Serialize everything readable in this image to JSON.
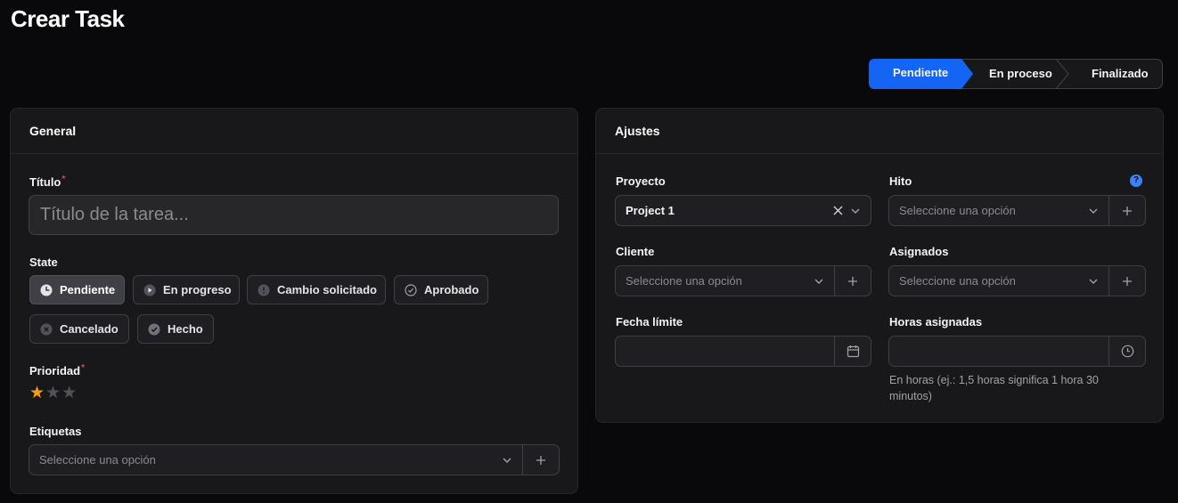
{
  "page": {
    "title": "Crear Task"
  },
  "stepper": {
    "steps": [
      {
        "label": "Pendiente",
        "active": true
      },
      {
        "label": "En proceso",
        "active": false
      },
      {
        "label": "Finalizado",
        "active": false
      }
    ],
    "active_color": "#1565f5"
  },
  "general": {
    "header": "General",
    "title_field": {
      "label": "Título",
      "required_mark": "*",
      "value": "",
      "placeholder": "Título de la tarea..."
    },
    "state": {
      "label": "State",
      "options": [
        {
          "label": "Pendiente",
          "icon": "clock-icon",
          "active": true
        },
        {
          "label": "En progreso",
          "icon": "play-icon",
          "active": false
        },
        {
          "label": "Cambio solicitado",
          "icon": "exclamation-icon",
          "active": false
        },
        {
          "label": "Aprobado",
          "icon": "check-circle-icon",
          "active": false
        },
        {
          "label": "Cancelado",
          "icon": "x-circle-icon",
          "active": false
        },
        {
          "label": "Hecho",
          "icon": "check-filled-icon",
          "active": false
        }
      ]
    },
    "priority": {
      "label": "Prioridad",
      "required_mark": "*",
      "rating": 1,
      "max": 3,
      "filled_color": "#f59e0b",
      "empty_color": "#52525b"
    },
    "tags": {
      "label": "Etiquetas",
      "placeholder": "Seleccione una opción"
    }
  },
  "settings": {
    "header": "Ajustes",
    "project": {
      "label": "Proyecto",
      "value": "Project 1"
    },
    "milestone": {
      "label": "Hito",
      "placeholder": "Seleccione una opción",
      "help": "?"
    },
    "client": {
      "label": "Cliente",
      "placeholder": "Seleccione una opción"
    },
    "assignees": {
      "label": "Asignados",
      "placeholder": "Seleccione una opción"
    },
    "due_date": {
      "label": "Fecha límite",
      "value": ""
    },
    "hours": {
      "label": "Horas asignadas",
      "value": "",
      "help_text": "En horas (ej.: 1,5 horas significa 1 hora 30 minutos)"
    }
  }
}
